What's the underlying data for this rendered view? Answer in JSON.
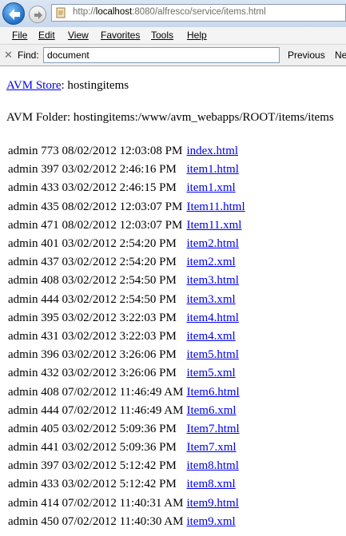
{
  "browser": {
    "url_prefix": "http://",
    "url_host": "localhost",
    "url_rest": ":8080/alfresco/service/items.html",
    "menu": [
      "File",
      "Edit",
      "View",
      "Favorites",
      "Tools",
      "Help"
    ],
    "find": {
      "label": "Find:",
      "value": "document",
      "previous_label": "Previous",
      "next_label": "Ne"
    }
  },
  "page": {
    "store_link": "AVM Store",
    "store_suffix": ": hostingitems",
    "folder_text": "AVM Folder: hostingitems:/www/avm_webapps/ROOT/items/items",
    "files": [
      {
        "meta": "admin 773 08/02/2012 12:03:08 PM",
        "name": "index.html"
      },
      {
        "meta": "admin 397 03/02/2012 2:46:16 PM",
        "name": "item1.html"
      },
      {
        "meta": "admin 433 03/02/2012 2:46:15 PM",
        "name": "item1.xml"
      },
      {
        "meta": "admin 435 08/02/2012 12:03:07 PM",
        "name": "Item11.html"
      },
      {
        "meta": "admin 471 08/02/2012 12:03:07 PM",
        "name": "Item11.xml"
      },
      {
        "meta": "admin 401 03/02/2012 2:54:20 PM",
        "name": "item2.html"
      },
      {
        "meta": "admin 437 03/02/2012 2:54:20 PM",
        "name": "item2.xml"
      },
      {
        "meta": "admin 408 03/02/2012 2:54:50 PM",
        "name": "item3.html"
      },
      {
        "meta": "admin 444 03/02/2012 2:54:50 PM",
        "name": "item3.xml"
      },
      {
        "meta": "admin 395 03/02/2012 3:22:03 PM",
        "name": "item4.html"
      },
      {
        "meta": "admin 431 03/02/2012 3:22:03 PM",
        "name": "item4.xml"
      },
      {
        "meta": "admin 396 03/02/2012 3:26:06 PM",
        "name": "item5.html"
      },
      {
        "meta": "admin 432 03/02/2012 3:26:06 PM",
        "name": "item5.xml"
      },
      {
        "meta": "admin 408 07/02/2012 11:46:49 AM",
        "name": "Item6.html"
      },
      {
        "meta": "admin 444 07/02/2012 11:46:49 AM",
        "name": "Item6.xml"
      },
      {
        "meta": "admin 405 03/02/2012 5:09:36 PM",
        "name": "Item7.html"
      },
      {
        "meta": "admin 441 03/02/2012 5:09:36 PM",
        "name": "Item7.xml"
      },
      {
        "meta": "admin 397 03/02/2012 5:12:42 PM",
        "name": "item8.html"
      },
      {
        "meta": "admin 433 03/02/2012 5:12:42 PM",
        "name": "item8.xml"
      },
      {
        "meta": "admin 414 07/02/2012 11:40:31 AM",
        "name": "item9.html"
      },
      {
        "meta": "admin 450 07/02/2012 11:40:30 AM",
        "name": "item9.xml"
      }
    ]
  },
  "icons": {
    "back": "back-arrow-icon",
    "forward": "forward-arrow-icon",
    "page": "page-icon",
    "close": "close-icon"
  },
  "colors": {
    "link": "#0000ee",
    "back_button": "#1f6fc6"
  }
}
